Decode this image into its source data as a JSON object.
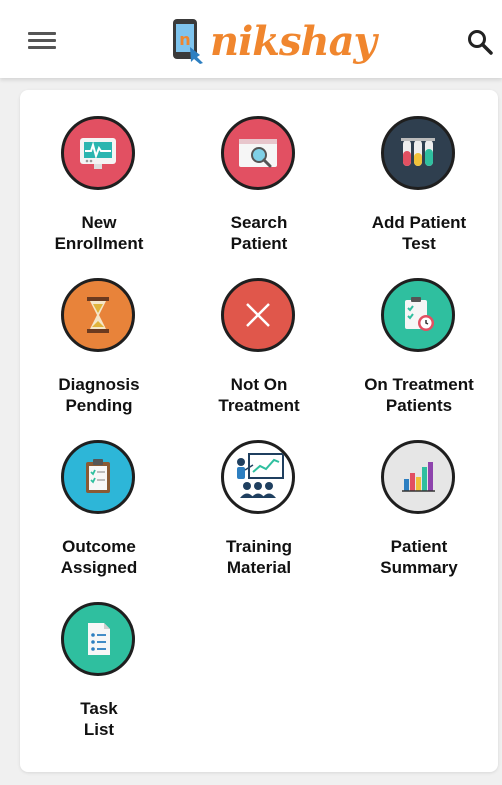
{
  "header": {
    "menu_icon": "hamburger-menu-icon",
    "logo_text": "nikshay",
    "search_icon": "search-icon"
  },
  "tiles": [
    {
      "line1": "New",
      "line2": "Enrollment",
      "color": "#e25062",
      "icon": "heart-monitor-icon"
    },
    {
      "line1": "Search",
      "line2": "Patient",
      "color": "#e25062",
      "icon": "search-browser-icon"
    },
    {
      "line1": "Add Patient",
      "line2": "Test",
      "color": "#2f3f4f",
      "icon": "test-tubes-icon"
    },
    {
      "line1": "Diagnosis",
      "line2": "Pending",
      "color": "#e8833a",
      "icon": "hourglass-icon"
    },
    {
      "line1": "Not On",
      "line2": "Treatment",
      "color": "#e0574b",
      "icon": "close-x-icon"
    },
    {
      "line1": "On Treatment",
      "line2": "Patients",
      "color": "#2fbf9f",
      "icon": "clipboard-clock-icon"
    },
    {
      "line1": "Outcome",
      "line2": "Assigned",
      "color": "#2db6d8",
      "icon": "clipboard-checklist-icon"
    },
    {
      "line1": "Training",
      "line2": "Material",
      "color": "#ffffff",
      "icon": "presentation-board-icon"
    },
    {
      "line1": "Patient",
      "line2": "Summary",
      "color": "#e6e6e6",
      "icon": "bar-chart-icon"
    },
    {
      "line1": "Task",
      "line2": "List",
      "color": "#2fbf9f",
      "icon": "document-list-icon"
    }
  ],
  "colors": {
    "brand_orange": "#f0862e",
    "brand_blue": "#2d7fc1"
  }
}
